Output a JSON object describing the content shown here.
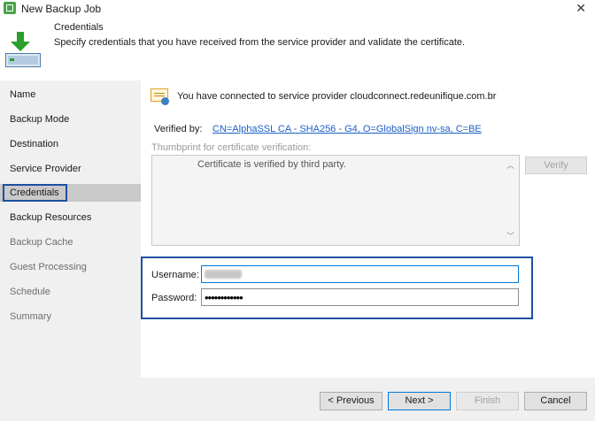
{
  "window": {
    "title": "New Backup Job",
    "close_glyph": "✕",
    "icon": "backup-job-icon"
  },
  "header": {
    "title": "Credentials",
    "subtitle": "Specify credentials that you have received from the service provider and validate the certificate.",
    "icon": "download-to-drive-icon"
  },
  "sidebar": {
    "items": [
      {
        "label": "Name",
        "state": "normal"
      },
      {
        "label": "Backup Mode",
        "state": "normal"
      },
      {
        "label": "Destination",
        "state": "normal"
      },
      {
        "label": "Service Provider",
        "state": "normal"
      },
      {
        "label": "Credentials",
        "state": "active"
      },
      {
        "label": "Backup Resources",
        "state": "normal"
      },
      {
        "label": "Backup Cache",
        "state": "dim"
      },
      {
        "label": "Guest Processing",
        "state": "dim"
      },
      {
        "label": "Schedule",
        "state": "dim"
      },
      {
        "label": "Summary",
        "state": "dim"
      }
    ]
  },
  "main": {
    "connected_text": "You have connected to service provider cloudconnect.redeunifique.com.br",
    "verified_label": "Verified by:",
    "verified_link": "CN=AlphaSSL CA - SHA256 - G4, O=GlobalSign nv-sa, C=BE",
    "thumbprint_label": "Thumbprint for certificate verification:",
    "thumbprint_text": "Certificate is verified by third party.",
    "verify_label": "Verify",
    "username_label": "Username:",
    "username_value": "",
    "password_label": "Password:",
    "password_value": "••••••••••••"
  },
  "footer": {
    "previous_label": "< Previous",
    "next_label": "Next >",
    "finish_label": "Finish",
    "cancel_label": "Cancel"
  },
  "colors": {
    "accent": "#0078d7",
    "highlight_border": "#1f4ea1",
    "link": "#1a5fc8",
    "arrow": "#2aa02a"
  }
}
